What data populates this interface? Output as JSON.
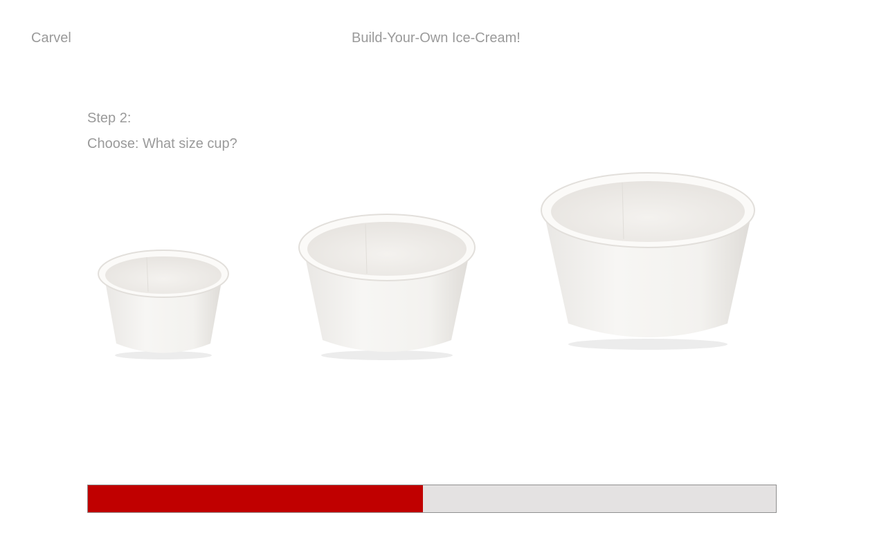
{
  "header": {
    "brand": "Carvel",
    "title": "Build-Your-Own Ice-Cream!"
  },
  "step": {
    "label": "Step 2:",
    "prompt": "Choose: What size cup?"
  },
  "cups": [
    {
      "name": "small",
      "icon": "cup-small-icon"
    },
    {
      "name": "medium",
      "icon": "cup-medium-icon"
    },
    {
      "name": "large",
      "icon": "cup-large-icon"
    }
  ],
  "progress": {
    "fraction": 0.487,
    "fill_color": "#c00000",
    "track_color": "#e4e2e2"
  }
}
